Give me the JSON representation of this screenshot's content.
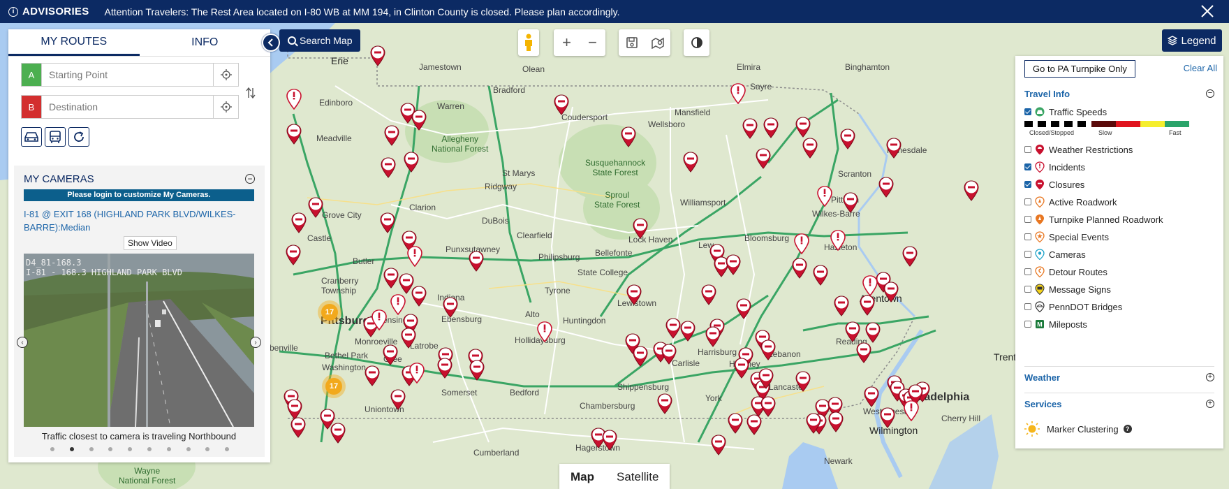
{
  "advisory": {
    "title": "ADVISORIES",
    "message": "Attention Travelers: The Rest Area located on I-80 WB at MM 194, in Clinton County is closed. Please plan accordingly."
  },
  "left_panel": {
    "tabs": [
      "MY ROUTES",
      "INFO"
    ],
    "start_placeholder": "Starting Point",
    "dest_placeholder": "Destination",
    "start_letter": "A",
    "dest_letter": "B",
    "cameras_title": "MY CAMERAS",
    "login_message": "Please login to customize My Cameras.",
    "camera_name": "I-81 @ EXIT 168 (HIGHLAND PARK BLVD/WILKES-BARRE):Median",
    "show_video": "Show Video",
    "camera_stamp": "D4_81-168.3\nI-81 - 168.3 HIGHLAND PARK BLVD",
    "caption": "Traffic closest to camera is traveling Northbound",
    "pages": 10,
    "active_page": 2
  },
  "toolbar": {
    "search_map": "Search Map",
    "zoom_in": "+",
    "zoom_out": "−",
    "legend": "Legend"
  },
  "map_type": {
    "map": "Map",
    "satellite": "Satellite"
  },
  "legend": {
    "turnpike_button": "Go to PA Turnpike Only",
    "clear_all": "Clear All",
    "travel_info": "Travel Info",
    "speed_labels": [
      "Closed/Stopped",
      "Slow",
      "Fast"
    ],
    "layers": [
      {
        "label": "Traffic Speeds",
        "checked": true,
        "icon": "car-icon"
      },
      {
        "label": "Weather Restrictions",
        "checked": false,
        "icon": "weather-restriction-icon"
      },
      {
        "label": "Incidents",
        "checked": true,
        "icon": "incident-icon"
      },
      {
        "label": "Closures",
        "checked": true,
        "icon": "closure-icon"
      },
      {
        "label": "Active Roadwork",
        "checked": false,
        "icon": "roadwork-icon"
      },
      {
        "label": "Turnpike Planned Roadwork",
        "checked": false,
        "icon": "turnpike-roadwork-icon"
      },
      {
        "label": "Special Events",
        "checked": false,
        "icon": "star-icon"
      },
      {
        "label": "Cameras",
        "checked": false,
        "icon": "camera-icon"
      },
      {
        "label": "Detour Routes",
        "checked": false,
        "icon": "detour-icon"
      },
      {
        "label": "Message Signs",
        "checked": false,
        "icon": "message-sign-icon"
      },
      {
        "label": "PennDOT Bridges",
        "checked": false,
        "icon": "bridge-icon"
      },
      {
        "label": "Mileposts",
        "checked": false,
        "icon": "milepost-icon"
      }
    ],
    "weather": "Weather",
    "services": "Services",
    "marker_clustering": "Marker Clustering"
  },
  "map_labels": {
    "erie": "Erie",
    "jamestown": "Jamestown",
    "olean": "Olean",
    "elmira": "Elmira",
    "binghamton": "Binghamton",
    "warren": "Warren",
    "bradford": "Bradford",
    "sayre": "Sayre",
    "edinboro": "Edinboro",
    "meadville": "Meadville",
    "coudersport": "Coudersport",
    "wellsboro": "Wellsboro",
    "mansfield": "Mansfield",
    "honesdale": "Honesdale",
    "allegheny": "Allegheny\nNational Forest",
    "stmarys": "St Marys",
    "susquehannock": "Susquehannock\nState Forest",
    "scranton": "Scranton",
    "ridgway": "Ridgway",
    "sproul": "Sproul\nState Forest",
    "clarion": "Clarion",
    "grovecity": "Grove City",
    "dubois": "DuBois",
    "williamsport": "Williamsport",
    "wilkesbarre": "Wilkes-Barre",
    "pittston": "Pittston",
    "castle": "Castle",
    "lockhaven": "Lock Haven",
    "clearfield": "Clearfield",
    "bloomsburg": "Bloomsburg",
    "hazleton": "Hazleton",
    "punxsutawney": "Punxsutawney",
    "butler": "Butler",
    "philipsburg": "Philipsburg",
    "bellefonte": "Bellefonte",
    "cranberry": "Cranberry\nTownship",
    "statecollege": "State College",
    "lewisburg": "Lew",
    "indiana": "Indiana",
    "tyrone": "Tyrone",
    "lewistown": "Lewistown",
    "allentown": "Allentown",
    "pittsburgh": "Pittsburgh",
    "ebensburg": "Ebensburg",
    "altoona": "Alto",
    "huntingdon": "Huntingdon",
    "monroeville": "Monroeville",
    "latrobe": "Latrobe",
    "hollidaysburg": "Hollidaysburg",
    "reading": "Reading",
    "harrisburg": "Harrisburg",
    "hershey": "Hershey",
    "lebanon": "Lebanon",
    "carlisle": "Carlisle",
    "bethelpark": "Bethel Park",
    "washington": "Washington",
    "greensburg": "Gree",
    "trenton": "Trenton",
    "lancaster": "Lancaster",
    "york": "York",
    "shippensburg": "Shippensburg",
    "chambersburg": "Chambersburg",
    "somerset": "Somerset",
    "bedford": "Bedford",
    "uniontown": "Uniontown",
    "westchester": "West Chester",
    "philadelphia": "Philadelphia",
    "cherryhill": "Cherry Hill",
    "wilmington": "Wilmington",
    "hagerstown": "Hagerstown",
    "cumberland": "Cumberland",
    "wayne": "Wayne\nNational Forest",
    "newark": "Newark",
    "benville": "benville",
    "jeannette": "ensing"
  },
  "clusters": [
    "17",
    "17"
  ]
}
